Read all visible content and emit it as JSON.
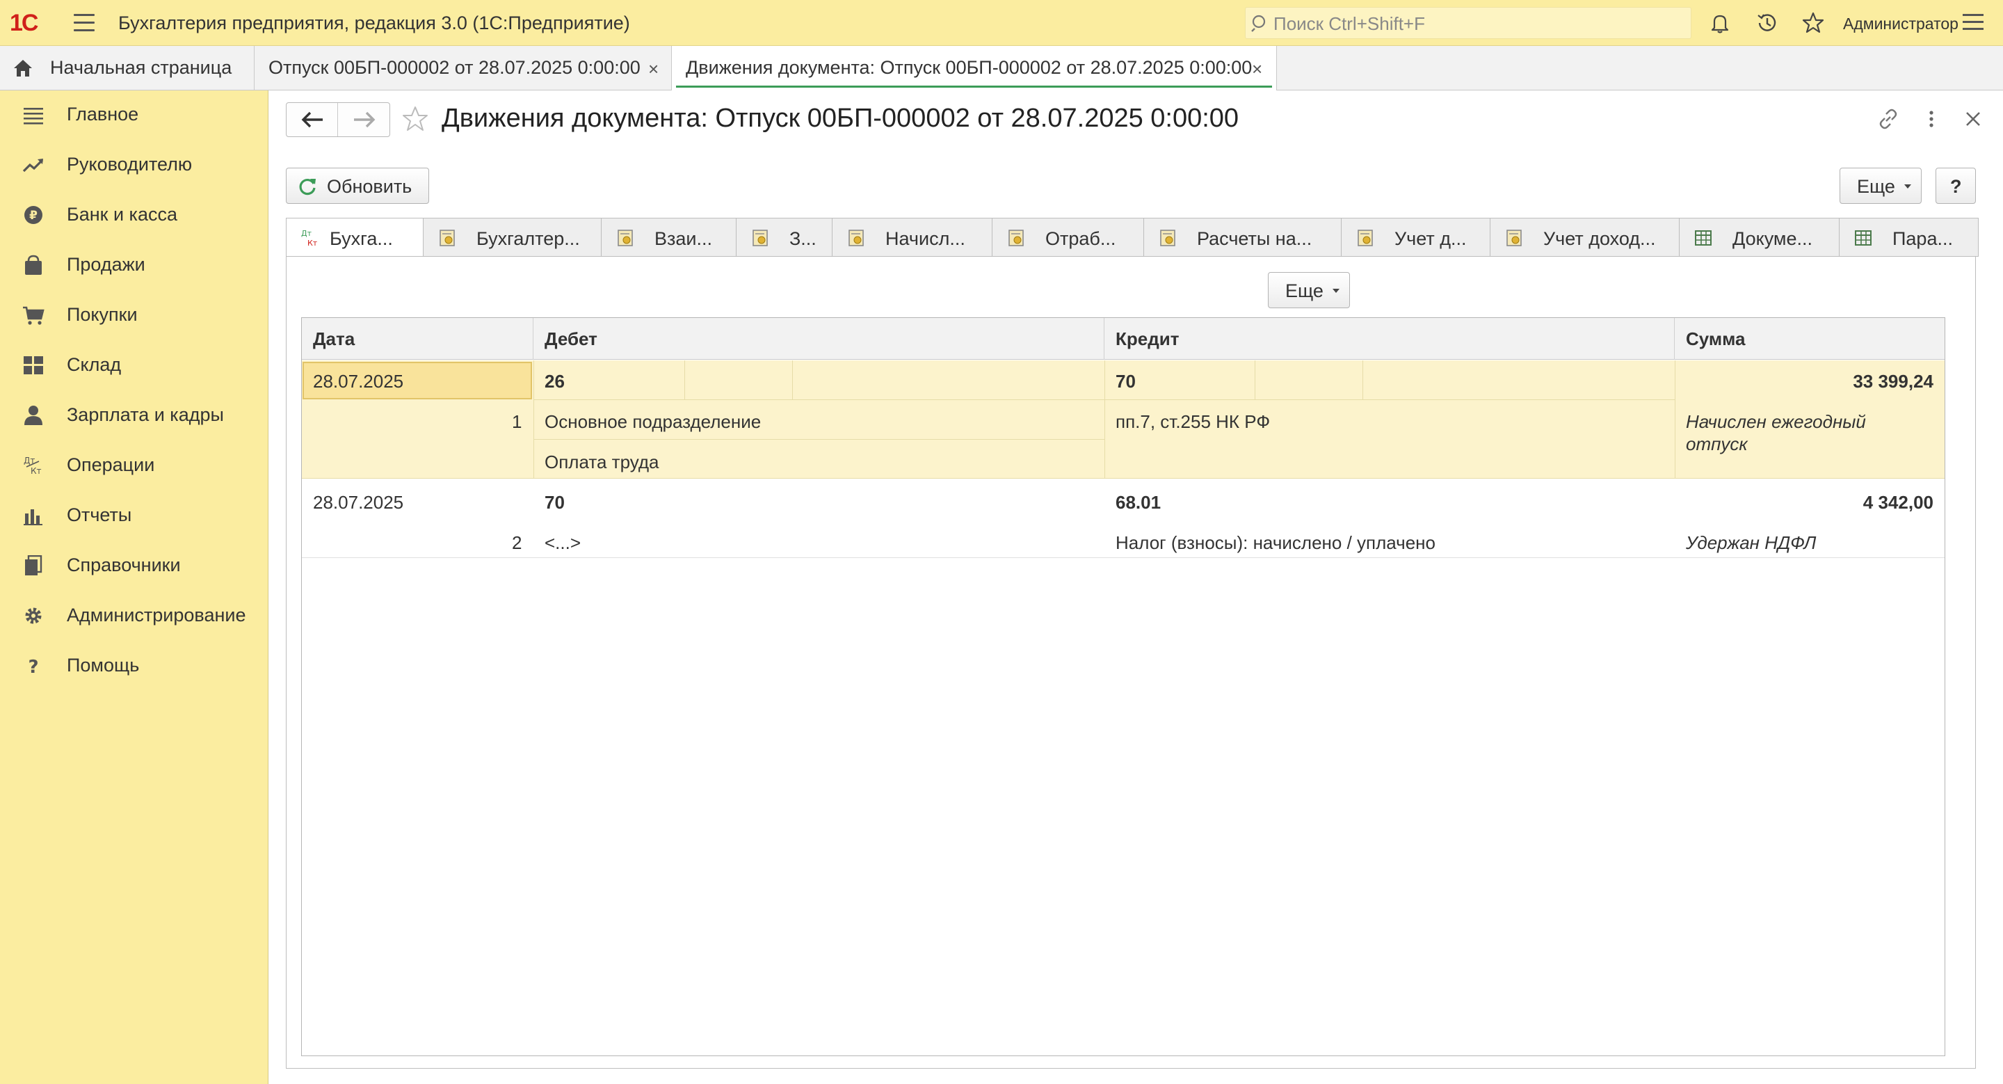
{
  "topbar": {
    "logo": "1С",
    "app_title": "Бухгалтерия предприятия, редакция 3.0  (1С:Предприятие)",
    "search_placeholder": "Поиск Ctrl+Shift+F",
    "user": "Администратор",
    "icons": [
      "bell-icon",
      "history-icon",
      "star-icon",
      "menu-lines-icon"
    ]
  },
  "tabs": {
    "home": "Начальная страница",
    "items": [
      {
        "label": "Отпуск 00БП-000002 от 28.07.2025 0:00:00",
        "active": false
      },
      {
        "label": "Движения документа: Отпуск 00БП-000002 от 28.07.2025 0:00:00",
        "active": true
      }
    ],
    "close_glyph": "×"
  },
  "sidebar": {
    "items": [
      {
        "label": "Главное",
        "icon": "list-icon"
      },
      {
        "label": "Руководителю",
        "icon": "trend-icon"
      },
      {
        "label": "Банк и касса",
        "icon": "ruble-icon"
      },
      {
        "label": "Продажи",
        "icon": "bag-icon"
      },
      {
        "label": "Покупки",
        "icon": "cart-icon"
      },
      {
        "label": "Склад",
        "icon": "warehouse-icon"
      },
      {
        "label": "Зарплата и кадры",
        "icon": "person-icon"
      },
      {
        "label": "Операции",
        "icon": "dt-kt-icon"
      },
      {
        "label": "Отчеты",
        "icon": "bar-chart-icon"
      },
      {
        "label": "Справочники",
        "icon": "books-icon"
      },
      {
        "label": "Администрирование",
        "icon": "gear-icon"
      },
      {
        "label": "Помощь",
        "icon": "question-icon"
      }
    ]
  },
  "form": {
    "title": "Движения документа: Отпуск 00БП-000002 от 28.07.2025 0:00:00",
    "refresh_label": "Обновить",
    "more_label": "Еще",
    "help_label": "?"
  },
  "register_tabs": [
    {
      "label": "Бухга...",
      "icon": "dt-kt-icon"
    },
    {
      "label": "Бухгалтер...",
      "icon": "register-icon"
    },
    {
      "label": "Взаи...",
      "icon": "register-icon"
    },
    {
      "label": "З...",
      "icon": "register-icon"
    },
    {
      "label": "Начисл...",
      "icon": "register-icon"
    },
    {
      "label": "Отраб...",
      "icon": "register-icon"
    },
    {
      "label": "Расчеты на...",
      "icon": "register-icon"
    },
    {
      "label": "Учет д...",
      "icon": "register-icon"
    },
    {
      "label": "Учет доход...",
      "icon": "register-icon"
    },
    {
      "label": "Докуме...",
      "icon": "table-icon"
    },
    {
      "label": "Пара...",
      "icon": "table-icon"
    }
  ],
  "table": {
    "columns": [
      "Дата",
      "Дебет",
      "Кредит",
      "Сумма"
    ],
    "rows": [
      {
        "date": "28.07.2025",
        "number": "1",
        "debit_account": "26",
        "debit_sub1": "Основное подразделение",
        "debit_sub2": "Оплата труда",
        "credit_account": "70",
        "credit_sub1": "пп.7, ст.255 НК РФ",
        "amount": "33 399,24",
        "content_line1": "Начислен ежегодный",
        "content_line2": "отпуск"
      },
      {
        "date": "28.07.2025",
        "number": "2",
        "debit_account": "70",
        "debit_sub1": "<...>",
        "credit_account": "68.01",
        "credit_sub1": "Налог (взносы): начислено / уплачено",
        "amount": "4 342,00",
        "content_line1": "Удержан НДФЛ"
      }
    ]
  },
  "colors": {
    "topbar_bg": "#fbeda0",
    "sidebar_bg": "#fbeda0",
    "selected_row_bg": "#fcf3cc",
    "selected_cell_bg": "#f9e39b",
    "active_tab_underline": "#3c9c58",
    "logo": "#d0201a"
  }
}
